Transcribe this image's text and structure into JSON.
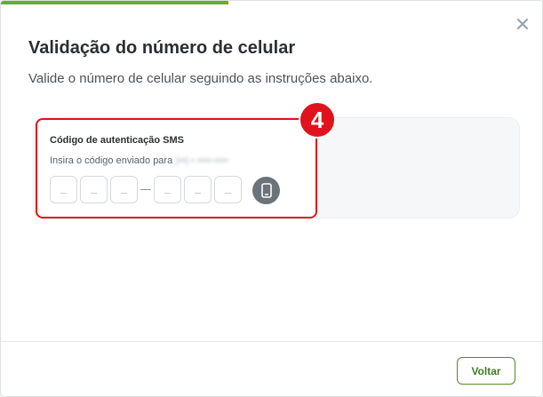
{
  "progress": {
    "fraction": 0.42,
    "color": "#6aac2c"
  },
  "modal": {
    "title": "Validação do número de celular",
    "subtitle": "Valide o número de celular seguindo as instruções abaixo.",
    "close_icon": "close-icon"
  },
  "step_badge": {
    "number": "4",
    "color": "#e0131c"
  },
  "sms": {
    "label": "Código de autenticação SMS",
    "hint": "Insira o código enviado para",
    "phone_masked": "(••) • ••••-••••",
    "code_placeholders": [
      "_",
      "_",
      "_",
      "_",
      "_",
      "_"
    ],
    "device_icon": "smartphone-icon"
  },
  "footer": {
    "back_label": "Voltar"
  }
}
